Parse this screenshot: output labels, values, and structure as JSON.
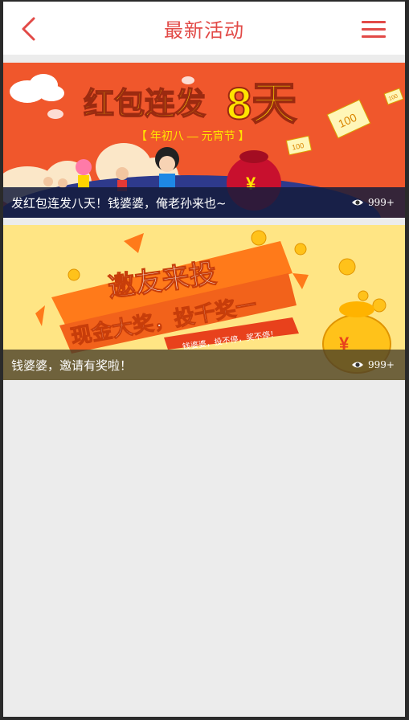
{
  "header": {
    "title": "最新活动",
    "back_icon": "chevron-left-icon",
    "menu_icon": "hamburger-menu-icon",
    "accent_color": "#e24a47"
  },
  "activities": [
    {
      "banner": {
        "headline": "红包连发",
        "big_number": "8天",
        "subline": "【 年初八 — 元宵节 】",
        "envelope_glyph": "¥",
        "bill_large": "100",
        "bill_small": "100",
        "bill_tiny": "100",
        "bg_color": "#f0572c"
      },
      "caption": "发红包连发八天！钱婆婆，俺老孙来也~",
      "views_icon": "eye-icon",
      "views": "999+"
    },
    {
      "banner": {
        "line1": "邀友来投",
        "line2": "现金大奖，投千奖一",
        "ribbon": "钱婆婆，投不停，奖不停！",
        "bag_glyph": "¥",
        "bg_color": "#ffe584"
      },
      "caption": "钱婆婆，邀请有奖啦！",
      "views_icon": "eye-icon",
      "views": "999+"
    }
  ]
}
